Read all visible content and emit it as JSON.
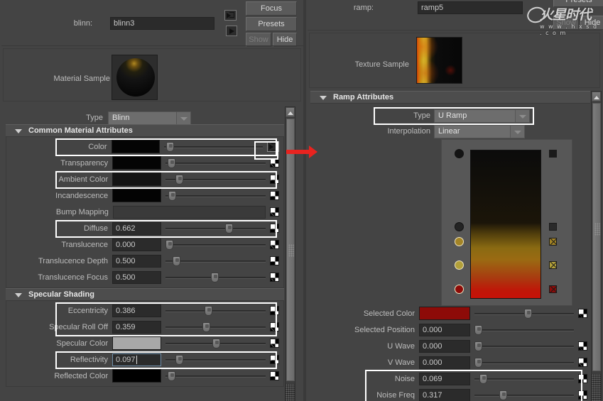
{
  "app": {
    "theme_bg": "#444444",
    "accent_red": "#e8231f"
  },
  "left_panel": {
    "node_label": "blinn:",
    "node_name": "blinn3",
    "buttons": {
      "focus": "Focus",
      "presets": "Presets",
      "show": "Show",
      "hide": "Hide"
    },
    "icons": {
      "load_attributes": "input-arrow-icon",
      "output_arrow": "output-arrow-icon"
    },
    "material_sample_label": "Material Sample",
    "type_label": "Type",
    "type_value": "Blinn",
    "sections": [
      {
        "title": "Common Material Attributes",
        "rows": [
          {
            "label": "Color",
            "kind": "color",
            "color": "#040404",
            "slider": 0.02,
            "map": "map-out-button",
            "highlight": true
          },
          {
            "label": "Transparency",
            "kind": "color",
            "color": "#040404",
            "slider": 0.02,
            "map": "checker-button"
          },
          {
            "label": "Ambient Color",
            "kind": "color",
            "color": "#131313",
            "slider": 0.1,
            "map": "checker-button",
            "highlight": true
          },
          {
            "label": "Incandescence",
            "kind": "color",
            "color": "#030303",
            "slider": 0.03,
            "map": "checker-button"
          },
          {
            "label": "Bump Mapping",
            "kind": "bump",
            "color": "#383838",
            "map": "checker-button"
          },
          {
            "label": "Diffuse",
            "kind": "number",
            "value": "0.662",
            "slider": 0.625,
            "map": "checker-button",
            "highlight": true
          },
          {
            "label": "Translucence",
            "kind": "number",
            "value": "0.000",
            "slider": 0.0,
            "map": "checker-button"
          },
          {
            "label": "Translucence Depth",
            "kind": "number",
            "value": "0.500",
            "slider": 0.075,
            "map": "checker-button"
          },
          {
            "label": "Translucence Focus",
            "kind": "number",
            "value": "0.500",
            "slider": 0.475,
            "map": "checker-button"
          }
        ]
      },
      {
        "title": "Specular Shading",
        "rows": [
          {
            "label": "Eccentricity",
            "kind": "number",
            "value": "0.386",
            "slider": 0.41,
            "map": "checker-button",
            "highlight": true
          },
          {
            "label": "Specular Roll Off",
            "kind": "number",
            "value": "0.359",
            "slider": 0.385,
            "map": "checker-button",
            "highlight": true
          },
          {
            "label": "Specular Color",
            "kind": "color",
            "color": "#a8a8a8",
            "slider": 0.49,
            "map": "checker-button"
          },
          {
            "label": "Reflectivity",
            "kind": "number",
            "value": "0.097",
            "slider": 0.1,
            "map": "checker-button",
            "highlight": true,
            "focused": true
          },
          {
            "label": "Reflected Color",
            "kind": "color",
            "color": "#000000",
            "slider": 0.02,
            "map": "checker-button"
          }
        ]
      }
    ]
  },
  "right_panel": {
    "node_label": "ramp:",
    "node_name": "ramp5",
    "buttons": {
      "presets": "Presets",
      "show": "Show",
      "hide": "Hide"
    },
    "texture_sample_label": "Texture Sample",
    "section_title": "Ramp Attributes",
    "type_label": "Type",
    "type_value": "U Ramp",
    "interpolation_label": "Interpolation",
    "interpolation_value": "Linear",
    "ramp_widget": {
      "gradient_stops": [
        {
          "pos": 0.0,
          "color": "#0b0b0b"
        },
        {
          "pos": 0.49,
          "color": "#1b1509"
        },
        {
          "pos": 0.56,
          "color": "#4e3c0c"
        },
        {
          "pos": 0.66,
          "color": "#8a6a12"
        },
        {
          "pos": 0.74,
          "color": "#9a6a12"
        },
        {
          "pos": 0.86,
          "color": "#a83c10"
        },
        {
          "pos": 0.95,
          "color": "#c01608"
        },
        {
          "pos": 1.0,
          "color": "#c71208"
        }
      ],
      "markers": [
        {
          "y_pct": 0.025,
          "color": "#141414",
          "square": "#1b1b1b",
          "square_x": false
        },
        {
          "y_pct": 0.515,
          "color": "#242424",
          "square": "#2a2a2a",
          "square_x": false
        },
        {
          "y_pct": 0.615,
          "color": "#a38426",
          "square": "#a38426",
          "square_x": true
        },
        {
          "y_pct": 0.77,
          "color": "#b2a03a",
          "square": "#b2a03a",
          "square_x": true
        },
        {
          "y_pct": 0.935,
          "color": "#8d0b08",
          "square": "#8d0b08",
          "square_x": true
        }
      ]
    },
    "rows": [
      {
        "label": "Selected Color",
        "kind": "color",
        "color": "#8d0b08",
        "slider": 0.545,
        "map": "checker-button"
      },
      {
        "label": "Selected Position",
        "kind": "number",
        "value": "0.000",
        "slider": 0.0,
        "map": "none"
      },
      {
        "label": "U Wave",
        "kind": "number",
        "value": "0.000",
        "slider": 0.0,
        "map": "checker-button"
      },
      {
        "label": "V Wave",
        "kind": "number",
        "value": "0.000",
        "slider": 0.0,
        "map": "checker-button"
      },
      {
        "label": "Noise",
        "kind": "number",
        "value": "0.069",
        "slider": 0.055,
        "map": "checker-button",
        "highlight": true
      },
      {
        "label": "Noise Freq",
        "kind": "number",
        "value": "0.317",
        "slider": 0.275,
        "map": "checker-button",
        "highlight": true
      }
    ]
  },
  "watermark": {
    "main": "火星时代",
    "sub": "w w w . h x s d . c o m"
  }
}
